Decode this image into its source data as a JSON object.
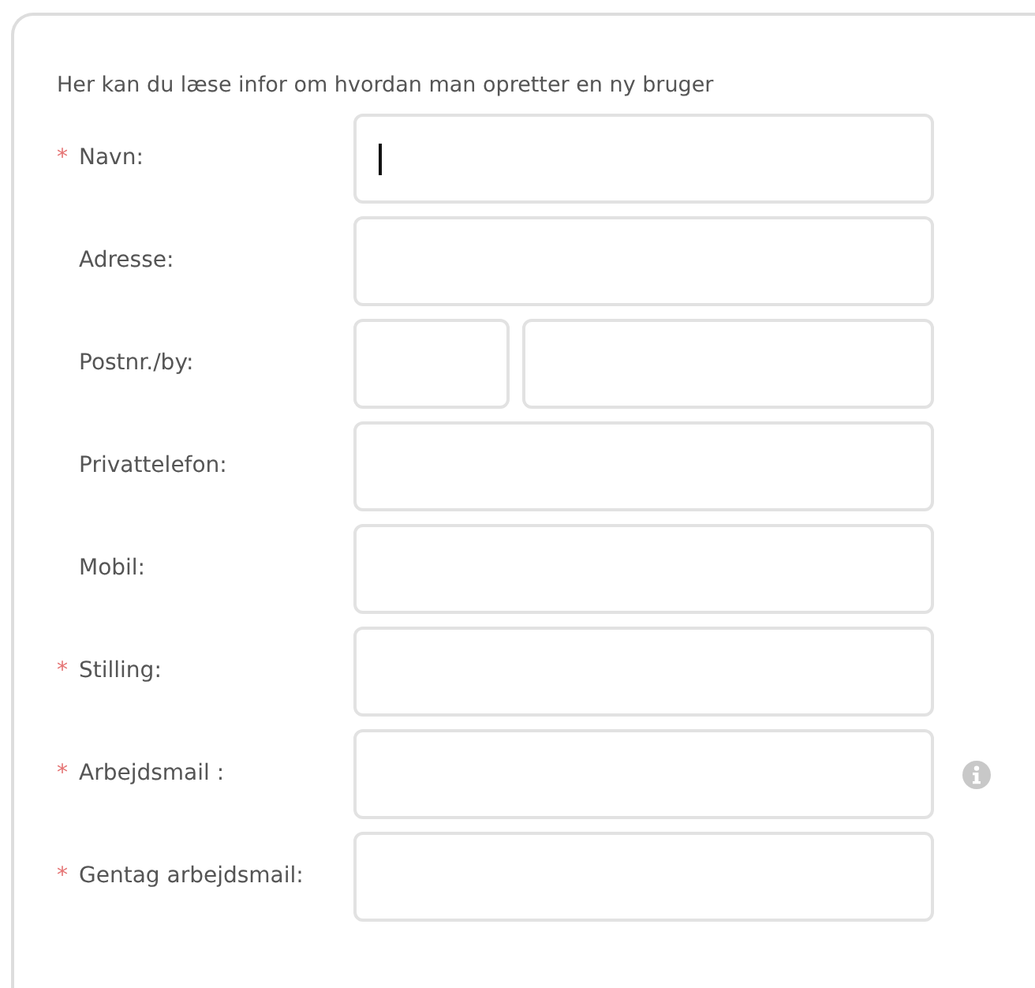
{
  "intro": "Her kan du læse infor om hvordan man opretter en ny bruger",
  "fields": [
    {
      "label": "Navn:",
      "marker": "*",
      "kind": "single",
      "focused": true
    },
    {
      "label": "Adresse:",
      "kind": "single",
      "focused": false
    },
    {
      "label": "Postnr./by:",
      "kind": "zip-city",
      "focused": false
    },
    {
      "label": "Privattelefon:",
      "kind": "single",
      "focused": false
    },
    {
      "label": "Mobil:",
      "kind": "single",
      "focused": false
    },
    {
      "label": "Stilling:",
      "marker": "*",
      "kind": "single",
      "focused": false
    },
    {
      "label": "Arbejdsmail :",
      "marker": "*",
      "kind": "single",
      "focused": false,
      "info": true
    },
    {
      "label": "Gentag arbejdsmail:",
      "marker": "*",
      "kind": "single",
      "focused": false
    }
  ]
}
